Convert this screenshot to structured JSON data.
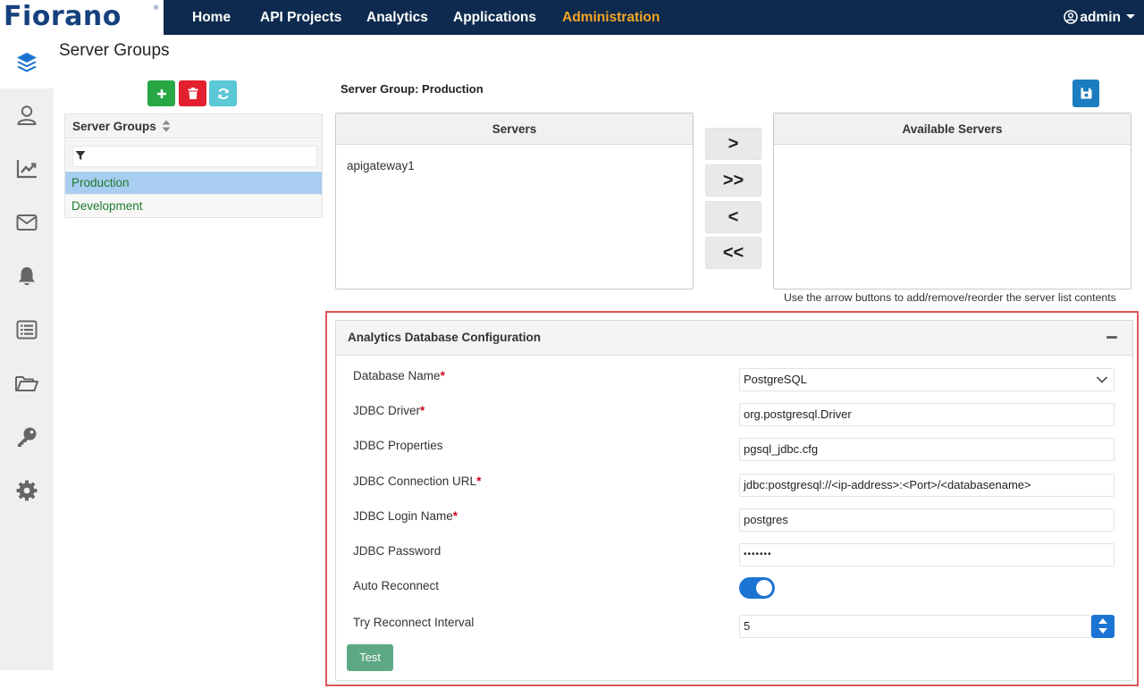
{
  "app": {
    "logo_text": "Fiorano",
    "nav": [
      {
        "label": "Home"
      },
      {
        "label": "API Projects"
      },
      {
        "label": "Analytics"
      },
      {
        "label": "Applications"
      },
      {
        "label": "Administration"
      }
    ],
    "active_nav": "Administration",
    "user": "admin"
  },
  "sidebar": {
    "icons": [
      "layers-icon",
      "user-icon",
      "chart-icon",
      "mail-icon",
      "bell-icon",
      "list-icon",
      "folder-icon",
      "key-icon",
      "gear-icon"
    ],
    "active": "layers-icon"
  },
  "page": {
    "title": "Server Groups"
  },
  "server_groups": {
    "header": "Server Groups",
    "filter_value": "",
    "items": [
      {
        "label": "Production",
        "selected": true
      },
      {
        "label": "Development",
        "selected": false
      }
    ]
  },
  "group_detail": {
    "title": "Server Group: Production",
    "servers_header": "Servers",
    "servers": [
      "apigateway1"
    ],
    "available_header": "Available Servers",
    "available": [],
    "arrow_buttons": [
      ">",
      ">>",
      "<",
      "<<"
    ],
    "hint": "Use the arrow buttons to add/remove/reorder the server list contents"
  },
  "db_config": {
    "title": "Analytics Database Configuration",
    "fields": {
      "db_name": {
        "label": "Database Name",
        "required": "*",
        "value": "PostgreSQL"
      },
      "jdbc_driver": {
        "label": "JDBC Driver",
        "required": "*",
        "value": "org.postgresql.Driver"
      },
      "jdbc_props": {
        "label": "JDBC Properties",
        "value": "pgsql_jdbc.cfg"
      },
      "jdbc_url": {
        "label": "JDBC Connection URL",
        "required": "*",
        "value": "jdbc:postgresql://<ip-address>:<Port>/<databasename>"
      },
      "jdbc_login": {
        "label": "JDBC Login Name",
        "required": "*",
        "value": "postgres"
      },
      "jdbc_password": {
        "label": "JDBC Password",
        "value": "•••••••"
      },
      "auto_reconnect": {
        "label": "Auto Reconnect",
        "enabled": true
      },
      "reconnect_interval": {
        "label": "Try Reconnect Interval",
        "value": "5"
      }
    },
    "test_label": "Test"
  },
  "colors": {
    "nav_bg": "#0e2a4e",
    "active_nav": "#f5a623",
    "accent_blue": "#1b74d3",
    "highlight_border": "#e05555"
  }
}
